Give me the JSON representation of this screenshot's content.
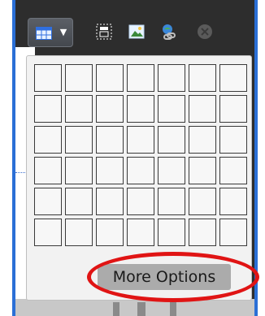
{
  "toolbar": {
    "icons": [
      "table-icon",
      "chevron-down-icon",
      "layout-icon",
      "image-icon",
      "link-icon",
      "disabled-icon"
    ]
  },
  "table_picker": {
    "rows": 6,
    "columns": 7,
    "more_options_label": "More Options"
  },
  "colors": {
    "frame": "#2b6fd6",
    "toolbar_bg": "#2d2d2d",
    "panel_bg": "#f2f2f2",
    "button_bg": "#ababab",
    "highlight": "#e01414"
  }
}
